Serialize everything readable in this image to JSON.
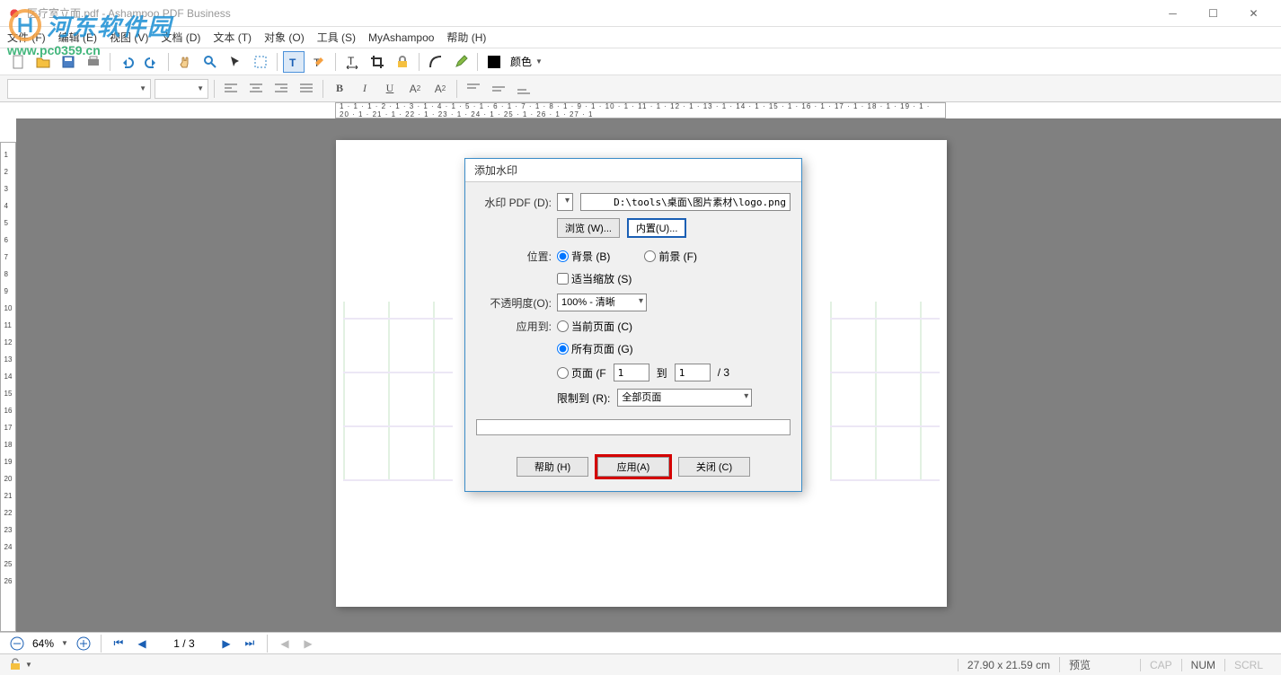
{
  "window": {
    "title": "医疗室立面.pdf - Ashampoo PDF Business"
  },
  "menu": {
    "file": "文件 (F)",
    "edit": "编辑 (E)",
    "view": "视图 (V)",
    "document": "文档 (D)",
    "text": "文本 (T)",
    "object": "对象 (O)",
    "tools": "工具 (S)",
    "myashampoo": "MyAshampoo",
    "help": "帮助 (H)"
  },
  "toolbar": {
    "color_label": "颜色"
  },
  "format": {
    "bold": "B",
    "italic": "I",
    "underline": "U",
    "super": "A",
    "sub": "A"
  },
  "dialog": {
    "title": "添加水印",
    "pdf_label": "水印 PDF (D):",
    "pdf_path": "D:\\tools\\桌面\\图片素材\\logo.png",
    "browse": "浏览 (W)...",
    "builtin": "内置(U)...",
    "position_label": "位置:",
    "bg": "背景 (B)",
    "fg": "前景 (F)",
    "fit": "适当缩放 (S)",
    "opacity_label": "不透明度(O):",
    "opacity_value": "100% - 清晰",
    "apply_to_label": "应用到:",
    "current_page": "当前页面 (C)",
    "all_pages": "所有页面 (G)",
    "pages_radio": "页面 (F",
    "page_from": "1",
    "page_to_label": "到",
    "page_to": "1",
    "page_total": "/ 3",
    "limit_label": "限制到 (R):",
    "limit_value": "全部页面",
    "help_btn": "帮助 (H)",
    "apply_btn": "应用(A)",
    "close_btn": "关闭 (C)"
  },
  "nav": {
    "zoom": "64%",
    "page": "1 / 3"
  },
  "status": {
    "coords": "27.90 x 21.59 cm",
    "mode": "预览",
    "cap": "CAP",
    "num": "NUM",
    "scrl": "SCRL"
  },
  "watermark": {
    "cn": "河东软件园",
    "url": "www.pc0359.cn"
  },
  "ruler": {
    "h": "1 · 1 · 1 · 2 · 1 · 3 · 1 · 4 · 1 · 5 · 1 · 6 · 1 · 7 · 1 · 8 · 1 · 9 · 1 · 10 · 1 · 11 · 1 · 12 · 1 · 13 · 1 · 14 · 1 · 15 · 1 · 16 · 1 · 17 · 1 · 18 · 1 · 19 · 1 · 20 · 1 · 21 · 1 · 22 · 1 · 23 · 1 · 24 · 1 · 25 · 1 · 26 · 1 · 27 · 1"
  }
}
